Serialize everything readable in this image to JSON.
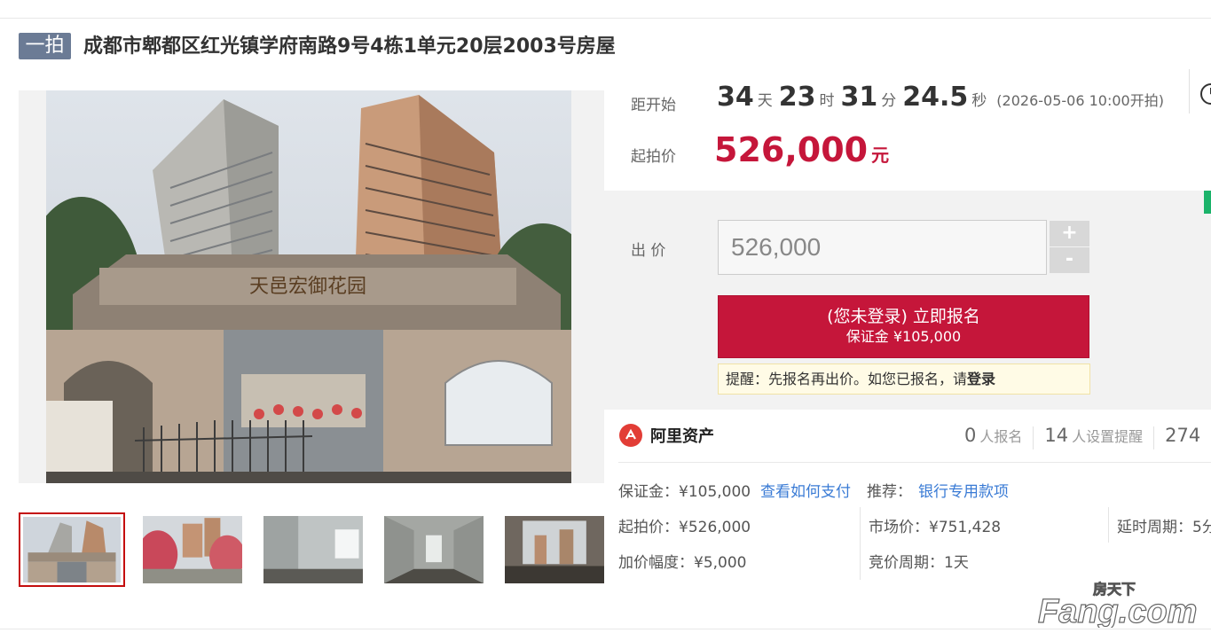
{
  "header": {
    "badge": "一拍",
    "title": "成都市郫都区红光镇学府南路9号4栋1单元20层2003号房屋"
  },
  "gallery": {
    "main_image": "main-photo-building-gate",
    "gate_sign": "天邑宏御花园",
    "thumbnails": [
      "thumb-gate",
      "thumb-courtyard",
      "thumb-room-window",
      "thumb-empty-room",
      "thumb-balcony-view"
    ],
    "active_index": 0
  },
  "countdown": {
    "label": "距开始",
    "days": "34",
    "days_unit": "天",
    "hours": "23",
    "hours_unit": "时",
    "minutes": "31",
    "minutes_unit": "分",
    "seconds": "24.5",
    "seconds_unit": "秒",
    "start_note": "(2026-05-06 10:00开拍)"
  },
  "start_price": {
    "label": "起拍价",
    "value": "526,000",
    "unit": "元"
  },
  "bid": {
    "label": "出 价",
    "input_value": "526,000",
    "plus": "+",
    "minus": "-",
    "register_line1": "(您未登录) 立即报名",
    "register_line2": "保证金 ¥105,000",
    "tip_text": "提醒：先报名再出价。如您已报名，请",
    "tip_login": "登录"
  },
  "platform": {
    "name": "阿里资产",
    "registered_count": "0",
    "registered_label": "人报名",
    "reminder_count": "14",
    "reminder_label": "人设置提醒",
    "views_partial": "274"
  },
  "details": {
    "deposit": "保证金：¥105,000",
    "how_to_pay": "查看如何支付",
    "recommend_label": "推荐：",
    "recommend_link": "银行专用款项",
    "start_price": "起拍价：¥526,000",
    "market_price": "市场价：¥751,428",
    "delay_period": "延时周期：5分",
    "increment": "加价幅度：¥5,000",
    "auction_period": "竞价周期：1天"
  },
  "watermark": {
    "top": "房天下",
    "main": "Fang.com"
  },
  "colors": {
    "accent_red": "#c5163a",
    "badge_blue": "#6b7b95",
    "link_blue": "#3a7bd5",
    "ali_red": "#e23d36",
    "tab_green": "#1bb36a"
  }
}
